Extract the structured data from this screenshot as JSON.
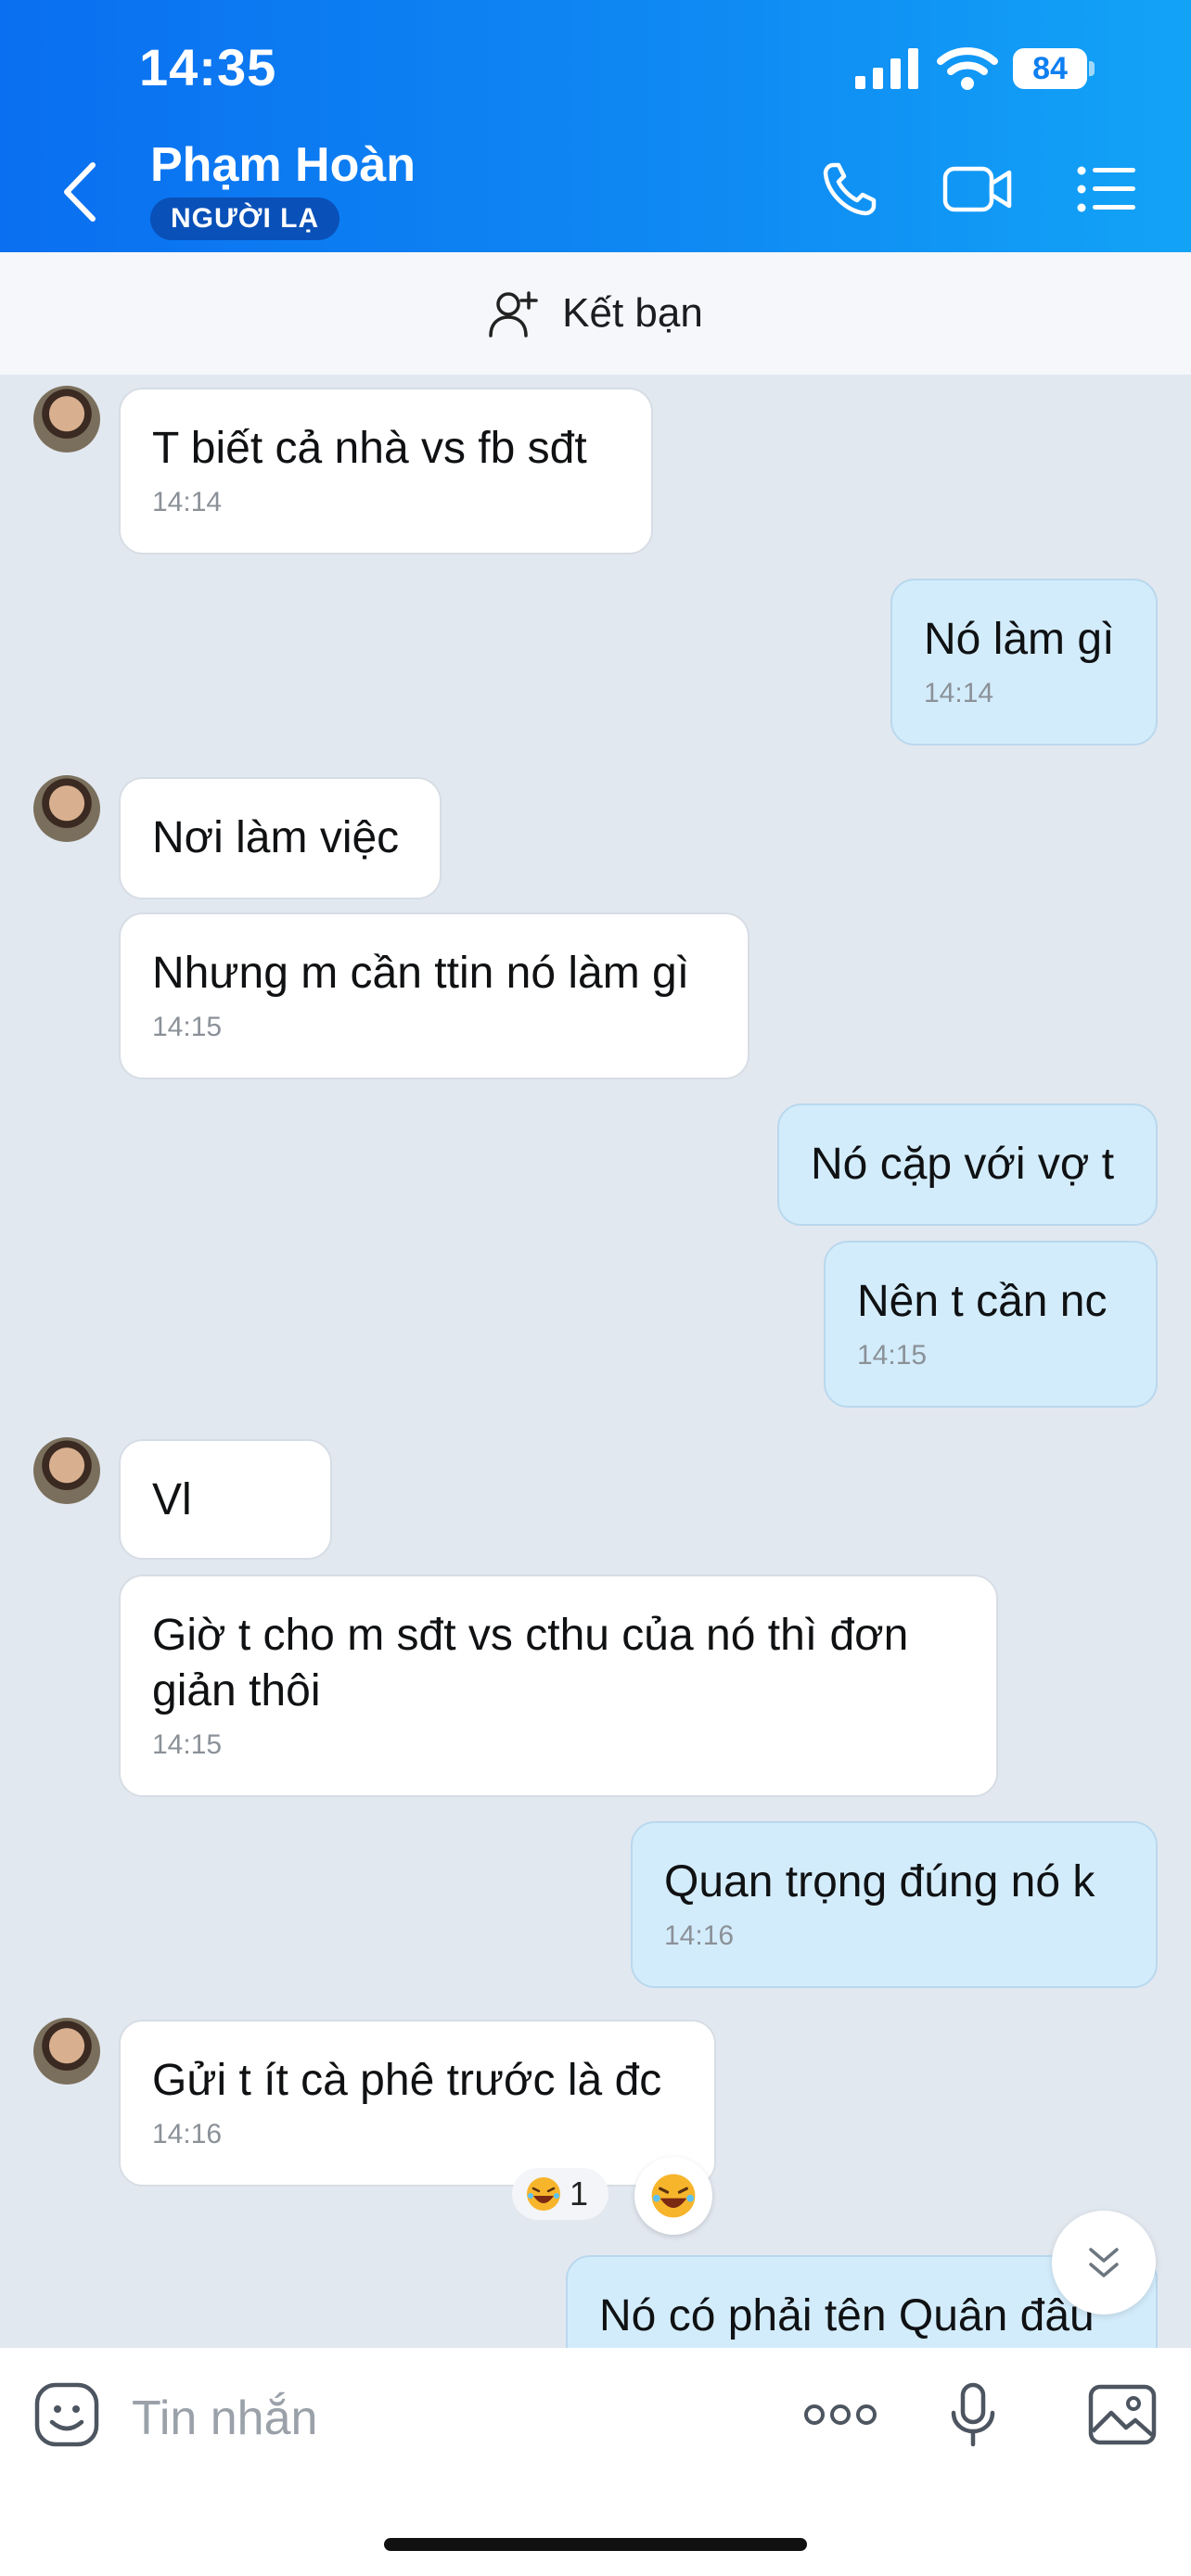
{
  "status_bar": {
    "time": "14:35",
    "battery": "84"
  },
  "header": {
    "contact_name": "Phạm Hoàn",
    "badge": "NGƯỜI LẠ",
    "icons": [
      "chevron-left-icon",
      "phone-icon",
      "video-call-icon",
      "menu-list-icon"
    ]
  },
  "friend_bar": {
    "label": "Kết bạn",
    "icon": "add-friend-icon"
  },
  "messages": [
    {
      "dir": "in",
      "text": "T biết cả nhà vs fb sđt",
      "time": "14:14"
    },
    {
      "dir": "out",
      "text": "Nó làm gì",
      "time": "14:14"
    },
    {
      "dir": "in",
      "text": "Nơi làm việc",
      "time": ""
    },
    {
      "dir": "in",
      "text": "Nhưng m cần ttin nó làm gì",
      "time": "14:15"
    },
    {
      "dir": "out",
      "text": "Nó cặp với vợ t",
      "time": ""
    },
    {
      "dir": "out",
      "text": "Nên t cần nc",
      "time": "14:15"
    },
    {
      "dir": "in",
      "text": "Vl",
      "time": ""
    },
    {
      "dir": "in",
      "text": "Giờ t cho m sđt vs cthu của nó thì đơn giản thôi",
      "time": "14:15"
    },
    {
      "dir": "out",
      "text": "Quan trọng đúng nó k",
      "time": "14:16"
    },
    {
      "dir": "in",
      "text": "Gửi t ít cà phê trước là đc",
      "time": "14:16"
    },
    {
      "dir": "out",
      "text": "Nó có phải tên Quân đâu",
      "time": ""
    }
  ],
  "reaction": {
    "emoji": "laughing-face-icon",
    "count": "1"
  },
  "composer": {
    "placeholder": "Tin nhắn",
    "icons": [
      "sticker-icon",
      "more-icon",
      "microphone-icon",
      "image-icon"
    ]
  },
  "colors": {
    "header": "#0f8af3",
    "incoming_bubble": "#ffffff",
    "outgoing_bubble": "#d3ecfb",
    "background": "#e2e8f0"
  }
}
